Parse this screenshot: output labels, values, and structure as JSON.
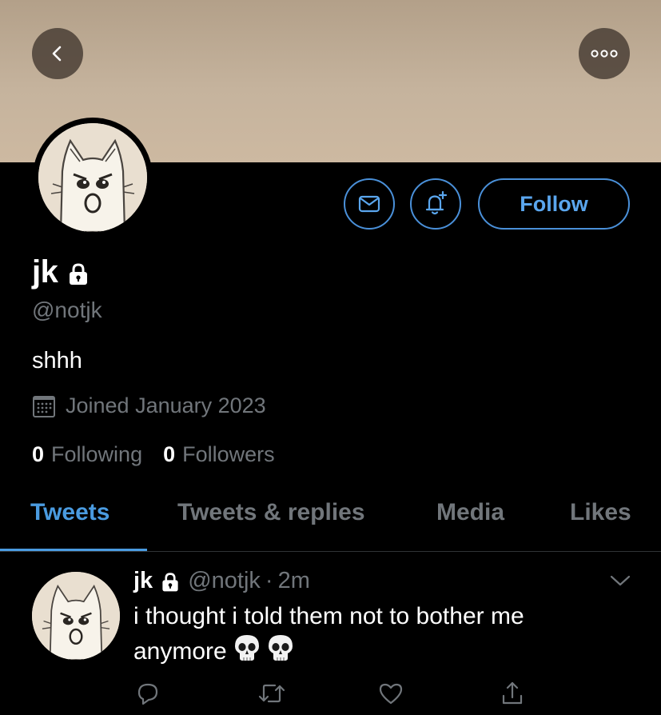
{
  "header": {
    "back_icon": "chevron-left-icon",
    "more_icon": "more-horizontal-icon",
    "banner_color": "#c5b39d"
  },
  "profile": {
    "name": "jk",
    "handle": "@notjk",
    "bio": "shhh",
    "joined": "Joined January 2023",
    "following_count": "0",
    "following_label": "Following",
    "followers_count": "0",
    "followers_label": "Followers",
    "protected": true
  },
  "actions": {
    "message_icon": "mail-icon",
    "notify_icon": "bell-plus-icon",
    "follow_label": "Follow",
    "accent_color": "#4a9be0"
  },
  "tabs": [
    {
      "label": "Tweets",
      "active": true
    },
    {
      "label": "Tweets & replies",
      "active": false
    },
    {
      "label": "Media",
      "active": false
    },
    {
      "label": "Likes",
      "active": false
    }
  ],
  "tweet": {
    "name": "jk",
    "handle": "@notjk",
    "separator": "·",
    "time": "2m",
    "text_line1": "i thought i told them not to bother me",
    "text_line2": "anymore",
    "emojis": [
      "skull",
      "skull"
    ],
    "action_icons": [
      "reply-icon",
      "retweet-icon",
      "like-icon",
      "share-icon"
    ]
  }
}
